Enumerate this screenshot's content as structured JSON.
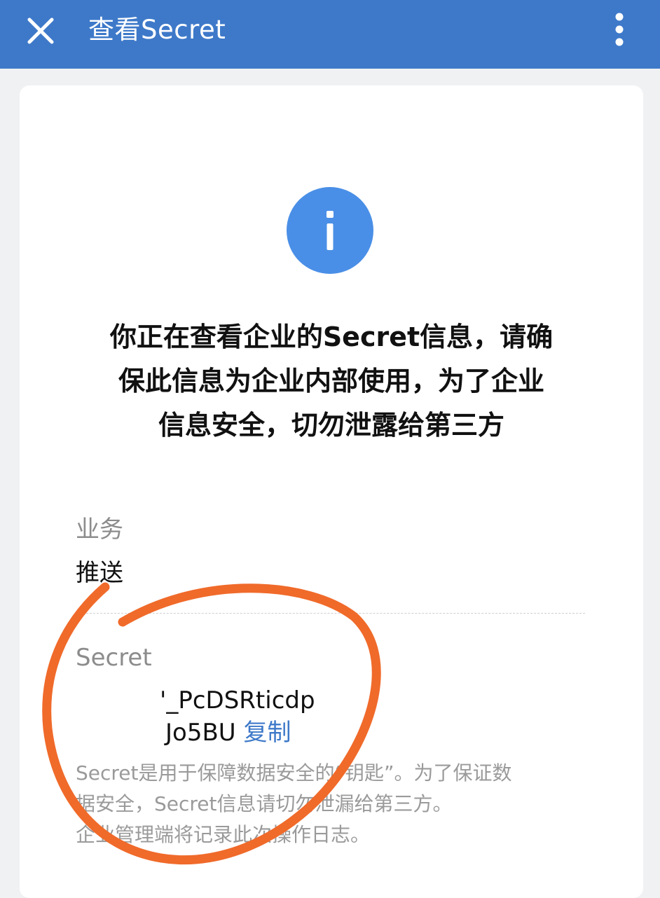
{
  "header": {
    "title": "查看Secret",
    "close_icon": "close-icon",
    "more_icon": "more-vertical-icon"
  },
  "main": {
    "info_icon": "info-icon",
    "warning_lines": [
      "你正在查看企业的Secret信息，请确",
      "保此信息为企业内部使用，为了企业",
      "信息安全，切勿泄露给第三方"
    ],
    "service_label": "业务",
    "service_value": "推送",
    "secret_label": "Secret",
    "secret_line1": "'_PcDSRticdp",
    "secret_line2": "Jo5BU",
    "copy_label": "复制",
    "note_lines": [
      "Secret是用于保障数据安全的“钥匙”。为了保证数",
      "据安全，Secret信息请切勿泄漏给第三方。",
      "企业管理端将记录此次操作日志。"
    ]
  },
  "colors": {
    "header_bg": "#3e79c9",
    "info_circle": "#4a8fe7",
    "link": "#3e79c9",
    "annotation": "#f06a2a"
  }
}
